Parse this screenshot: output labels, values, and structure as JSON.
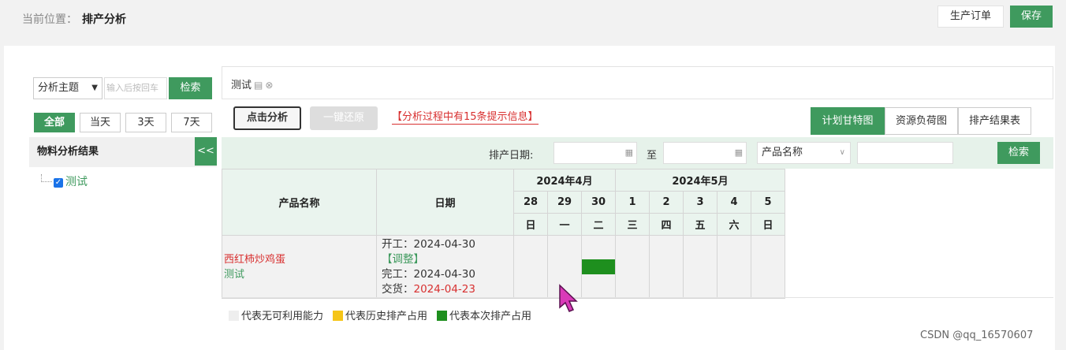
{
  "breadcrumb": {
    "prefix": "当前位置：",
    "current": "排产分析"
  },
  "header": {
    "order_label": "生产订单",
    "save_label": "保存"
  },
  "left": {
    "subject_select": "分析主题",
    "search_placeholder": "输入后按回车",
    "search_label": "检索",
    "ranges": [
      "全部",
      "当天",
      "3天",
      "7天"
    ],
    "section_title": "物料分析结果",
    "collapse": "<<",
    "tree_item": "测试"
  },
  "tab": {
    "label": "测试"
  },
  "toolbar": {
    "analyze_label": "点击分析",
    "restore_label": "一键还原",
    "hint": "【分析过程中有15条提示信息】",
    "views": [
      "计划甘特图",
      "资源负荷图",
      "排产结果表"
    ]
  },
  "filter": {
    "date_label": "排产日期:",
    "to_label": "至",
    "product_select": "产品名称",
    "search_label": "检索"
  },
  "grid": {
    "col_product": "产品名称",
    "col_date": "日期",
    "months": [
      {
        "label": "2024年4月",
        "span": 3
      },
      {
        "label": "2024年5月",
        "span": 5
      }
    ],
    "days": [
      {
        "num": "28",
        "wd": "日"
      },
      {
        "num": "29",
        "wd": "一"
      },
      {
        "num": "30",
        "wd": "二"
      },
      {
        "num": "1",
        "wd": "三"
      },
      {
        "num": "2",
        "wd": "四"
      },
      {
        "num": "3",
        "wd": "五"
      },
      {
        "num": "4",
        "wd": "六"
      },
      {
        "num": "5",
        "wd": "日"
      }
    ],
    "row": {
      "product": "西红柿炒鸡蛋",
      "sub": "测试",
      "start": "开工：2024-04-30",
      "adjust": "【调整】",
      "finish": "完工：2024-04-30",
      "delivery_label": "交货：",
      "delivery_date": "2024-04-23",
      "scheduled_day_index": 2
    }
  },
  "legend": [
    {
      "label": "代表无可利用能力",
      "color": "#eeeeee"
    },
    {
      "label": "代表历史排产占用",
      "color": "#f5c518"
    },
    {
      "label": "代表本次排产占用",
      "color": "#1e8f1e"
    }
  ],
  "watermark": "CSDN @qq_16570607"
}
